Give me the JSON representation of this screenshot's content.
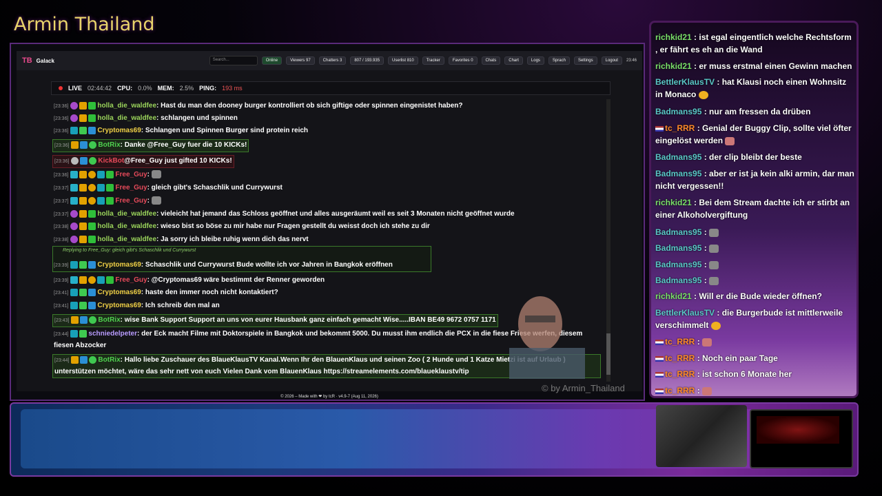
{
  "stream": {
    "title": "Armin Thailand",
    "watermark": "© by Armin_Thailand"
  },
  "app": {
    "logo": "TB",
    "name": "Galack",
    "search_placeholder": "Search...",
    "buttons": {
      "online": "Online",
      "viewers": "Viewers 97",
      "chatters": "Chatters 3",
      "msgs": "807 / 193.935",
      "userlist": "Userlist 810",
      "tracker": "Tracker",
      "favorites": "Favorites 0",
      "chats": "Chats",
      "chart": "Chart",
      "logs": "Logs",
      "sprach": "Sprach",
      "settings": "Settings",
      "logout": "Logout"
    },
    "time": "23:46",
    "status": {
      "live_label": "LIVE",
      "live_time": "02:44:42",
      "cpu_label": "CPU:",
      "cpu": "0.0%",
      "mem_label": "MEM:",
      "mem": "2.5%",
      "ping_label": "PING:",
      "ping": "193 ms"
    },
    "footer": "© 2026 – Made with ❤ by tcR · v4.9-7 (Aug 11, 2026)"
  },
  "chat": [
    {
      "ts": "[23:36]",
      "user": "holla_die_waldfee",
      "text": "Hast du man den dooney burger kontrolliert ob sich giftige oder spinnen eingenistet haben?"
    },
    {
      "ts": "[23:36]",
      "user": "holla_die_waldfee",
      "text": "schlangen und spinnen"
    },
    {
      "ts": "[23:36]",
      "user": "Cryptomas69",
      "text": "Schlangen und Spinnen Burger sind protein reich"
    },
    {
      "ts": "[23:36]",
      "user": "BotRix",
      "text": "Danke @Free_Guy fuer die 10 KICKs!"
    },
    {
      "ts": "[23:36]",
      "user": "KickBot",
      "text": "@Free_Guy just gifted 10 KICKs!"
    },
    {
      "ts": "[23:36]",
      "user": "Free_Guy",
      "text": ""
    },
    {
      "ts": "[23:37]",
      "user": "Free_Guy",
      "text": "gleich gibt's Schaschlik und Currywurst"
    },
    {
      "ts": "[23:37]",
      "user": "Free_Guy",
      "text": ""
    },
    {
      "ts": "[23:37]",
      "user": "holla_die_waldfee",
      "text": "vieleicht hat jemand das Schloss geöffnet und alles ausgeräumt weil es seit 3 Monaten nicht geöffnet wurde"
    },
    {
      "ts": "[23:38]",
      "user": "holla_die_waldfee",
      "text": "wieso bist so böse zu mir habe nur Fragen gestellt du weisst doch ich stehe zu dir"
    },
    {
      "ts": "[23:38]",
      "user": "holla_die_waldfee",
      "text": "Ja sorry ich bleibe ruhig wenn dich das nervt"
    },
    {
      "ts": "[23:39]",
      "user": "Cryptomas69",
      "text": "Schaschlik und Currywurst Bude wollte ich vor Jahren in Bangkok eröffnen",
      "reply": "Replying to Free_Guy: gleich gibt's Schaschlik und Currywurst"
    },
    {
      "ts": "[23:39]",
      "user": "Free_Guy",
      "text": "@Cryptomas69 wäre bestimmt der Renner geworden"
    },
    {
      "ts": "[23:41]",
      "user": "Cryptomas69",
      "text": "haste den immer noch nicht kontaktiert?"
    },
    {
      "ts": "[23:41]",
      "user": "Cryptomas69",
      "text": "Ich schreib den mal an"
    },
    {
      "ts": "[23:43]",
      "user": "BotRix",
      "text": "wise Bank Support Support an uns von eurer Hausbank ganz einfach gemacht Wise.....IBAN BE49 9672 0757 1171"
    },
    {
      "ts": "[23:44]",
      "user": "schniedelpeter",
      "text": "der Eck macht Filme mit Doktorspiele in Bangkok und bekommt 5000. Du musst ihm endlich die PCX in die fiese Friese werfen, diesem fiesen Abzocker"
    },
    {
      "ts": "[23:44]",
      "user": "BotRix",
      "text": "Hallo liebe Zuschauer des BlaueKlausTV Kanal.Wenn Ihr den BlauenKlaus und seinen Zoo ( 2 Hunde und 1 Katze Mietzi ist auf Urlaub ) unterstützen möchtet, wäre das sehr nett von euch Vielen Dank vom BlauenKlaus https://streamelements.com/blaueklaustv/tip"
    }
  ],
  "side_chat": [
    {
      "user": "richkid21",
      "text": ": ist egal eingentlich welche Rechtsform , er fährt es eh an die Wand"
    },
    {
      "user": "richkid21",
      "text": ": er muss erstmal einen Gewinn machen"
    },
    {
      "user": "BettlerKlausTV",
      "text": ": hat Klausi noch einen Wohnsitz in Monaco"
    },
    {
      "user": "Badmans95",
      "text": ": nur am fressen da drüben"
    },
    {
      "user": "tc_RRR",
      "text": ": Genial der Buggy Clip, sollte viel öfter eingelöst werden"
    },
    {
      "user": "Badmans95",
      "text": ": der clip bleibt der beste"
    },
    {
      "user": "Badmans95",
      "text": ": aber er ist ja kein alki armin, dar man nicht vergessen!!"
    },
    {
      "user": "richkid21",
      "text": ": Bei dem Stream dachte ich er stirbt an einer Alkoholvergiftung"
    },
    {
      "user": "Badmans95",
      "text": ":"
    },
    {
      "user": "Badmans95",
      "text": ":"
    },
    {
      "user": "Badmans95",
      "text": ":"
    },
    {
      "user": "Badmans95",
      "text": ":"
    },
    {
      "user": "richkid21",
      "text": ": Will er die Bude wieder öffnen?"
    },
    {
      "user": "BettlerKlausTV",
      "text": ": die Burgerbude ist mittlerweile verschimmelt"
    },
    {
      "user": "tc_RRR",
      "text": ":"
    },
    {
      "user": "tc_RRR",
      "text": ": Noch ein paar Tage"
    },
    {
      "user": "tc_RRR",
      "text": ": ist schon 6 Monate her"
    },
    {
      "user": "tc_RRR",
      "text": ":"
    }
  ]
}
